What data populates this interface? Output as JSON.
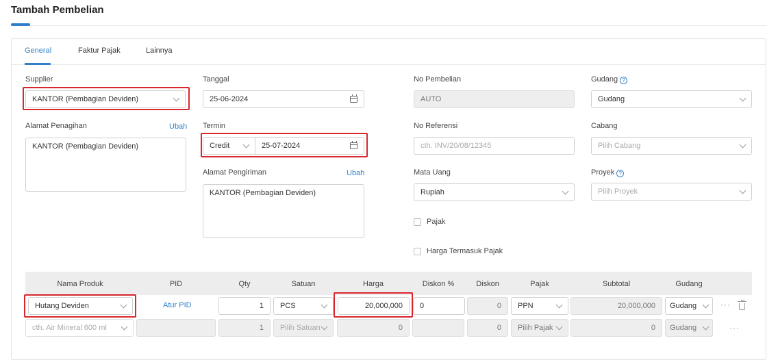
{
  "page": {
    "title": "Tambah Pembelian"
  },
  "tabs": [
    {
      "label": "General",
      "active": true
    },
    {
      "label": "Faktur Pajak",
      "active": false
    },
    {
      "label": "Lainnya",
      "active": false
    }
  ],
  "form": {
    "supplier": {
      "label": "Supplier",
      "value": "KANTOR (Pembagian Deviden)"
    },
    "alamat_penagihan": {
      "label": "Alamat Penagihan",
      "link": "Ubah",
      "value": "KANTOR (Pembagian Deviden)"
    },
    "tanggal": {
      "label": "Tanggal",
      "value": "25-06-2024"
    },
    "termin": {
      "label": "Termin",
      "type_value": "Credit",
      "date_value": "25-07-2024"
    },
    "alamat_pengiriman": {
      "label": "Alamat Pengiriman",
      "link": "Ubah",
      "value": "KANTOR (Pembagian Deviden)"
    },
    "no_pembelian": {
      "label": "No Pembelian",
      "value": "AUTO"
    },
    "no_referensi": {
      "label": "No Referensi",
      "placeholder": "cth. INV/20/08/12345"
    },
    "mata_uang": {
      "label": "Mata Uang",
      "value": "Rupiah"
    },
    "pajak_checkbox": {
      "label": "Pajak"
    },
    "harga_termasuk_pajak": {
      "label": "Harga Termasuk Pajak"
    },
    "gudang": {
      "label": "Gudang",
      "value": "Gudang"
    },
    "cabang": {
      "label": "Cabang",
      "placeholder": "Pilih Cabang"
    },
    "proyek": {
      "label": "Proyek",
      "placeholder": "Pilih Proyek"
    },
    "help_glyph": "?"
  },
  "table": {
    "headers": [
      "Nama Produk",
      "PID",
      "Qty",
      "Satuan",
      "Harga",
      "Diskon %",
      "Diskon",
      "Pajak",
      "Subtotal",
      "Gudang"
    ],
    "rows": [
      {
        "produk": "Hutang Deviden",
        "pid_link": "Atur PID",
        "qty": "1",
        "satuan": "PCS",
        "harga": "20,000,000",
        "diskon_pct": "0",
        "diskon": "0",
        "pajak": "PPN",
        "subtotal": "20,000,000",
        "gudang": "Gudang",
        "more": "···"
      },
      {
        "produk_placeholder": "cth. Air Mineral 600 ml",
        "qty": "1",
        "satuan_placeholder": "Pilih Satuan",
        "harga": "0",
        "diskon": "0",
        "pajak_placeholder": "Pilih Pajak",
        "subtotal": "0",
        "gudang": "Gudang",
        "more": "···"
      }
    ]
  },
  "colors": {
    "accent": "#2f80c9",
    "highlight": "#d9262c"
  }
}
